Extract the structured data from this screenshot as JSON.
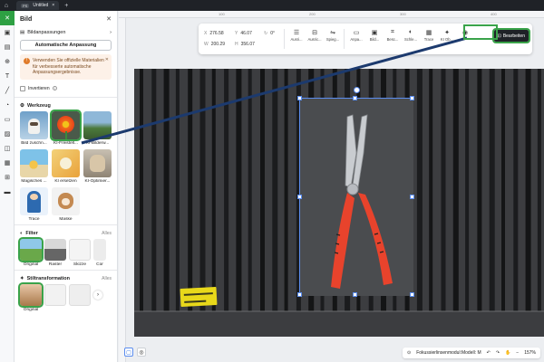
{
  "app": {
    "tab_title": "Untitled",
    "tab_badge": "PS"
  },
  "panel": {
    "title": "Bild",
    "adjust_label": "Bildanpassungen",
    "auto_button": "Automatische Anpassung",
    "warning_text": "Verwenden Sie offizielle Materialien für verbesserte automatische Anpassungsergebnisse.",
    "invert_label": "Invertieren",
    "tools_title": "Werkzeug",
    "tools": [
      {
        "label": "Bild zuschn...",
        "icon": "dog-photo"
      },
      {
        "label": "KI-Freistell...",
        "icon": "flower-photo"
      },
      {
        "label": "KI-Bilderw...",
        "icon": "landscape-photo"
      },
      {
        "label": "Magisches ...",
        "icon": "beach-photo"
      },
      {
        "label": "KI ersetzen",
        "icon": "floral-photo"
      },
      {
        "label": "KI-Optimier...",
        "icon": "cat-photo"
      },
      {
        "label": "Trace",
        "icon": "figure-photo"
      },
      {
        "label": "Maske",
        "icon": "puppy-photo"
      }
    ],
    "filter_title": "Filter",
    "filter_more": "Alles",
    "filters": [
      "Original",
      "Raster",
      "Skizze",
      "Cor"
    ],
    "style_title": "Stiltransformation",
    "style_more": "Alles",
    "styles": [
      "Original"
    ]
  },
  "toolbar": {
    "x_label": "X",
    "x_value": "276.58",
    "y_label": "Y",
    "y_value": "46.07",
    "w_label": "W",
    "w_value": "200.29",
    "h_label": "H",
    "h_value": "356.07",
    "rotation": "0°",
    "buttons": [
      {
        "label": "Ausri...",
        "icon": "align-icon"
      },
      {
        "label": "Ausric...",
        "icon": "distribute-icon"
      },
      {
        "label": "Spieg...",
        "icon": "mirror-icon"
      },
      {
        "label": "Anpa...",
        "icon": "adjust-icon"
      },
      {
        "label": "Bild...",
        "icon": "image-icon"
      },
      {
        "label": "Besc...",
        "icon": "crop-icon"
      },
      {
        "label": "Schle...",
        "icon": "veil-icon"
      },
      {
        "label": "Trace",
        "icon": "trace-icon"
      },
      {
        "label": "KI Ob...",
        "icon": "ai-icon"
      }
    ],
    "edit_label": "Bearbeiten"
  },
  "ruler": {
    "ticks": [
      "100",
      "200",
      "300",
      "400"
    ]
  },
  "bottom": {
    "module_label": "Fokussierlinsenmodul:Modell: M",
    "zoom": "157%"
  },
  "colors": {
    "accent": "#3aa34a",
    "dark": "#1f2227",
    "selection": "#5b8def",
    "pliers_red": "#e8432c",
    "arrow": "#1c3a6e"
  }
}
